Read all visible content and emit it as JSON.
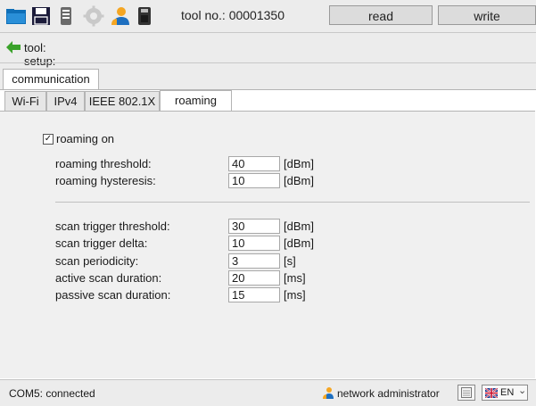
{
  "toolbar": {
    "icons": [
      "folder-icon",
      "save-icon",
      "device-icon",
      "gear-icon",
      "user-icon",
      "usb-icon"
    ],
    "tool_no": "tool no.: 00001350",
    "read_label": "read",
    "write_label": "write"
  },
  "breadcrumb": {
    "text": "tool: setup:",
    "icon": "back-arrow-icon"
  },
  "outer_tabs": [
    {
      "label": "communication",
      "active": true
    }
  ],
  "inner_tabs": [
    {
      "label": "Wi-Fi",
      "active": false
    },
    {
      "label": "IPv4",
      "active": false
    },
    {
      "label": "IEEE 802.1X",
      "active": false
    },
    {
      "label": "roaming",
      "active": true
    }
  ],
  "roaming": {
    "enabled_label": "roaming on",
    "enabled": true,
    "checkmark": "✓",
    "group1": [
      {
        "label": "roaming threshold:",
        "value": "40",
        "unit": "[dBm]"
      },
      {
        "label": "roaming hysteresis:",
        "value": "10",
        "unit": "[dBm]"
      }
    ],
    "group2": [
      {
        "label": "scan trigger threshold:",
        "value": "30",
        "unit": "[dBm]"
      },
      {
        "label": "scan trigger delta:",
        "value": "10",
        "unit": "[dBm]"
      },
      {
        "label": "scan periodicity:",
        "value": "3",
        "unit": "[s]"
      },
      {
        "label": "active scan duration:",
        "value": "20",
        "unit": "[ms]"
      },
      {
        "label": "passive scan duration:",
        "value": "15",
        "unit": "[ms]"
      }
    ]
  },
  "status": {
    "connection": "COM5: connected",
    "user": "network administrator",
    "language": "EN",
    "dropdown": "⌄"
  },
  "colors": {
    "accent_orange": "#f5a623",
    "accent_blue": "#1e6fc0",
    "arrow_green": "#3aa22a"
  }
}
